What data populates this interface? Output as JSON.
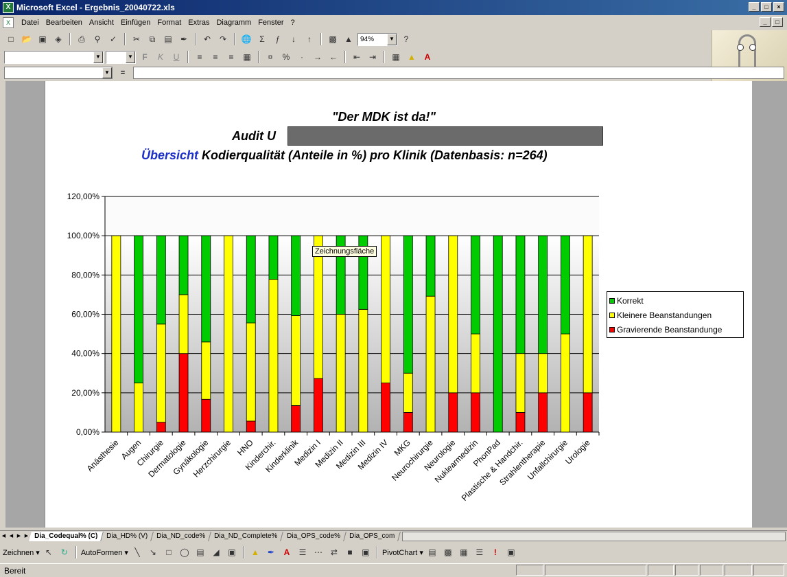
{
  "window": {
    "title": "Microsoft Excel - Ergebnis_20040722.xls",
    "buttons": [
      "_",
      "□",
      "×"
    ]
  },
  "menu": [
    "Datei",
    "Bearbeiten",
    "Ansicht",
    "Einfügen",
    "Format",
    "Extras",
    "Diagramm",
    "Fenster",
    "?"
  ],
  "toolbar": {
    "zoom": "94%"
  },
  "formatbar": {
    "bold": "F",
    "italic": "K",
    "underline": "U"
  },
  "formula": {
    "eq": "="
  },
  "chart_data": {
    "type": "bar",
    "stacked": true,
    "title_line1": "\"Der MDK ist da!\"",
    "title_line2": "Audit U",
    "title_line3_prefix": "Übersicht",
    "title_line3": "Kodierqualität (Anteile in %) pro Klinik (Datenbasis: n=264)",
    "ylim": [
      0,
      120
    ],
    "yticks": [
      "0,00%",
      "20,00%",
      "40,00%",
      "60,00%",
      "80,00%",
      "100,00%",
      "120,00%"
    ],
    "grid": true,
    "legend_position": "right",
    "categories": [
      "Anästhesie",
      "Augen",
      "Chirurgie",
      "Dermatologie",
      "Gynäkologie",
      "Herzchirurgie",
      "HNO",
      "Kinderchir.",
      "Kinderklinik",
      "Medizin I",
      "Medizin II",
      "Medizin III",
      "Medizin IV",
      "MKG",
      "Neurochirurgie",
      "Neurologie",
      "Nuklearmedizin",
      "PhonPad",
      "Plastische & Handchir.",
      "Strahlentherapie",
      "Unfallchirurgie",
      "Urologie"
    ],
    "series": [
      {
        "name": "Gravierende Beanstandunge",
        "color": "#ff0000",
        "values": [
          0,
          0,
          5,
          40,
          16.7,
          0,
          5.6,
          0,
          13.5,
          27.3,
          0,
          0,
          25,
          10,
          0,
          20,
          20,
          0,
          10,
          20,
          0,
          20
        ]
      },
      {
        "name": "Kleinere Beanstandungen",
        "color": "#ffff00",
        "values": [
          100,
          25,
          50,
          30,
          29.2,
          100,
          50,
          77.8,
          45.8,
          72.7,
          60,
          62.5,
          75,
          20,
          69.2,
          80,
          30,
          0,
          30,
          20,
          50,
          80
        ]
      },
      {
        "name": "Korrekt",
        "color": "#00cc00",
        "values": [
          0,
          75,
          45,
          30,
          54.1,
          0,
          44.4,
          22.2,
          40.7,
          0,
          40,
          37.5,
          0,
          70,
          30.8,
          0,
          50,
          100,
          60,
          60,
          50,
          0
        ]
      }
    ],
    "legend_order": [
      "Korrekt",
      "Kleinere Beanstandungen",
      "Gravierende Beanstandunge"
    ],
    "tooltip": "Zeichnungsfläche"
  },
  "sheets": [
    "Dia_Codequal% (C)",
    "Dia_HD% (V)",
    "Dia_ND_code%",
    "Dia_ND_Complete%",
    "Dia_OPS_code%",
    "Dia_OPS_com"
  ],
  "drawing": {
    "zeichnen": "Zeichnen ▾",
    "autoformen": "AutoFormen ▾",
    "pivot": "PivotChart ▾"
  },
  "status": "Bereit"
}
